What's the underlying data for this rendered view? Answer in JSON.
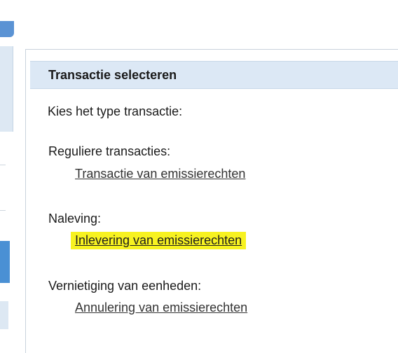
{
  "panel": {
    "title": "Transactie selecteren",
    "prompt": "Kies het type transactie:",
    "sections": [
      {
        "heading": "Reguliere transacties:",
        "link": "Transactie van emissierechten",
        "highlighted": false
      },
      {
        "heading": "Naleving:",
        "link": "Inlevering van emissierechten",
        "highlighted": true
      },
      {
        "heading": "Vernietiging van eenheden:",
        "link": "Annulering van emissierechten",
        "highlighted": false
      }
    ]
  },
  "colors": {
    "header_bg": "#dce8f5",
    "highlight": "#f7f221",
    "accent_blue": "#5b93d4"
  }
}
